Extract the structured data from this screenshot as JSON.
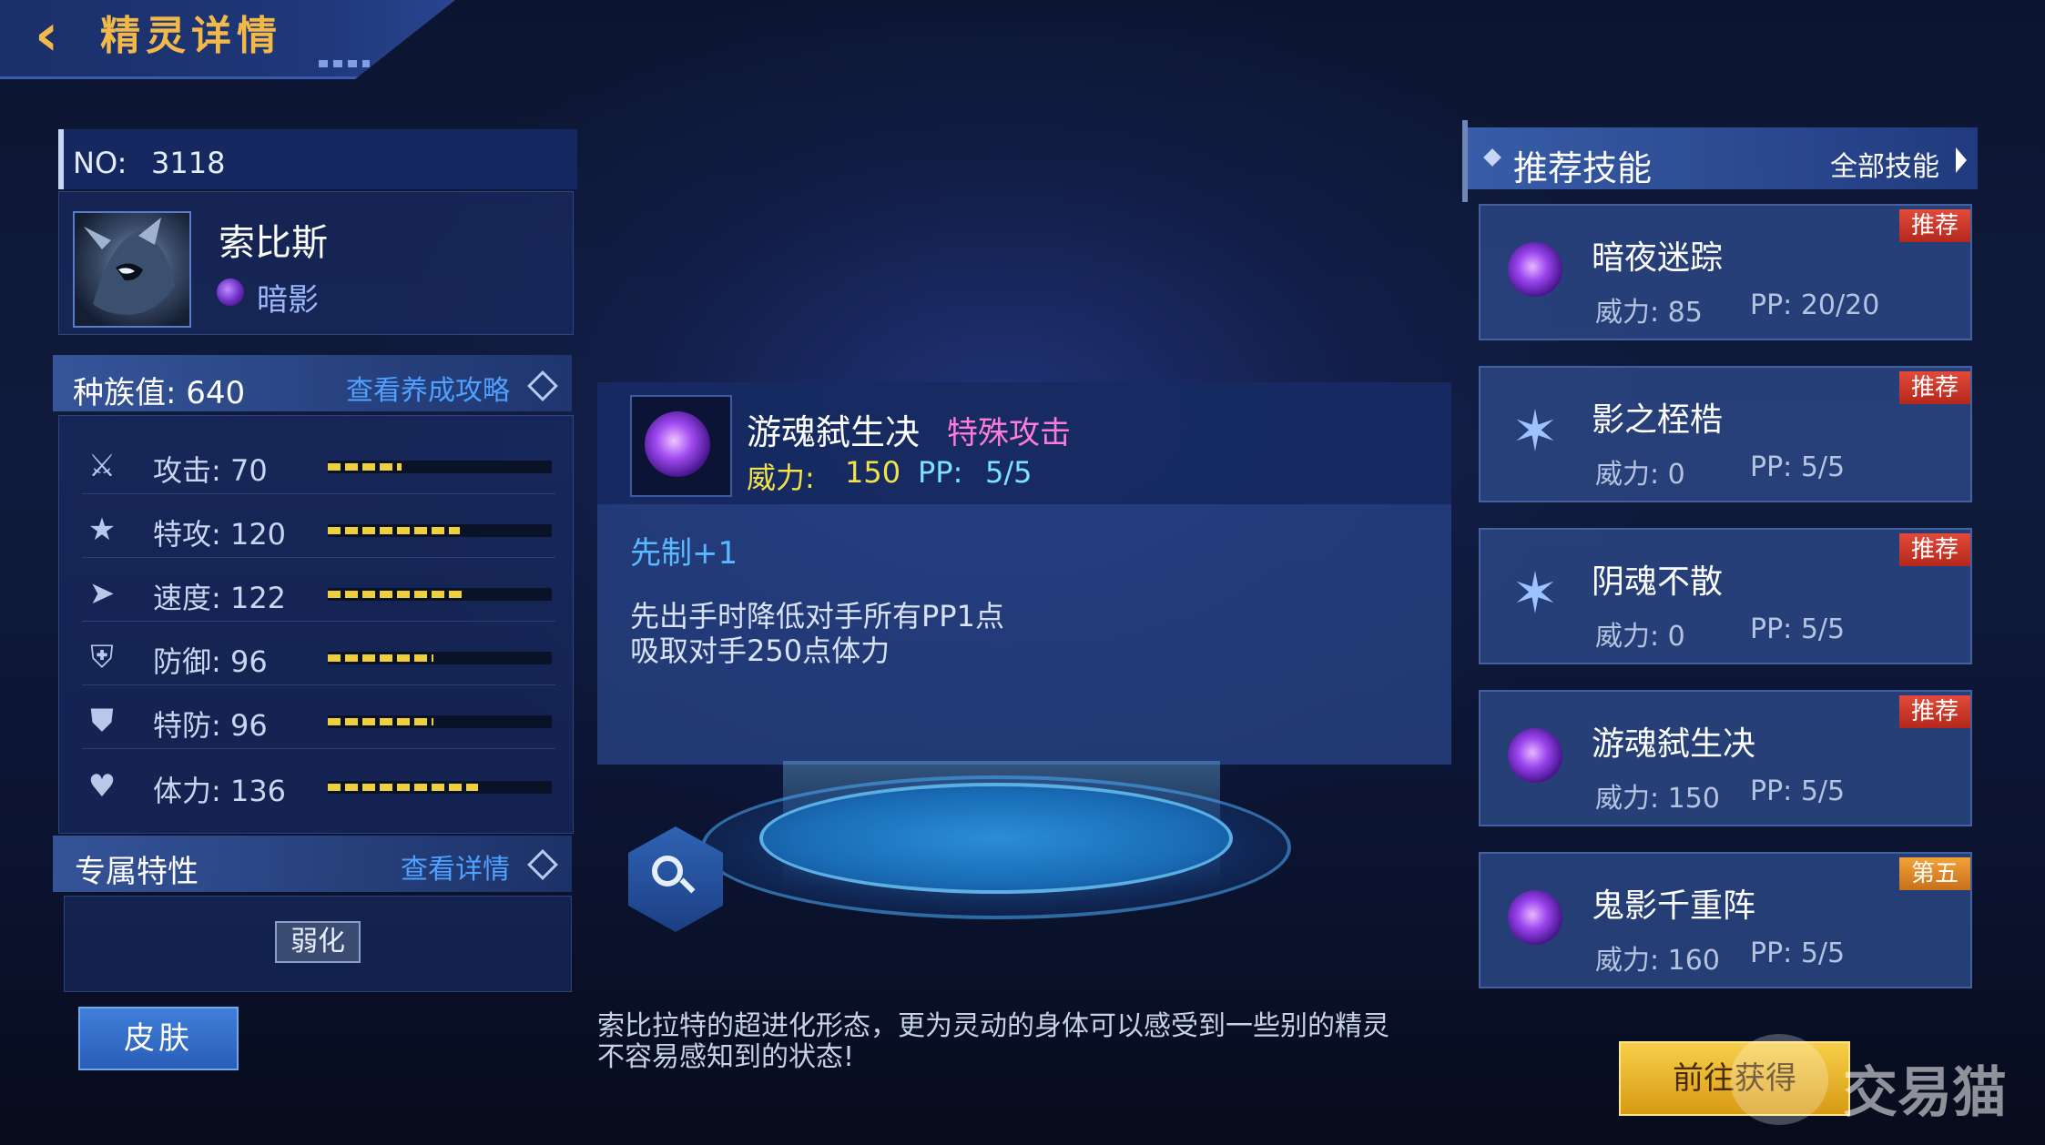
{
  "header": {
    "title": "精灵详情"
  },
  "pet": {
    "no_label": "NO:",
    "no_value": "3118",
    "name": "索比斯",
    "type": "暗影"
  },
  "race": {
    "label": "种族值:  640",
    "link": "查看养成攻略"
  },
  "stats": [
    {
      "label": "攻击:  70",
      "icon": "sword-icon",
      "fill": 0.33
    },
    {
      "label": "特攻:  120",
      "icon": "spark-icon",
      "fill": 0.59
    },
    {
      "label": "速度:  122",
      "icon": "boot-icon",
      "fill": 0.6
    },
    {
      "label": "防御:  96",
      "icon": "shield-icon",
      "fill": 0.47
    },
    {
      "label": "特防:  96",
      "icon": "magic-shield-icon",
      "fill": 0.47
    },
    {
      "label": "体力:  136",
      "icon": "heart-icon",
      "fill": 0.67
    }
  ],
  "trait": {
    "label": "专属特性",
    "link": "查看详情",
    "tag": "弱化"
  },
  "skin_button": "皮肤",
  "skill_detail": {
    "name": "游魂弑生决",
    "category": "特殊攻击",
    "power_label": "威力:",
    "power_value": "150",
    "pp_label": "PP:",
    "pp_value": "5/5",
    "priority": "先制+1",
    "effect_line1": "先出手时降低对手所有PP1点",
    "effect_line2": "吸取对手250点体力"
  },
  "description": {
    "line1": "索比拉特的超进化形态，更为灵动的身体可以感受到一些别的精灵",
    "line2": "不容易感知到的状态!"
  },
  "recommend": {
    "title": "推荐技能",
    "all_link": "全部技能",
    "skills": [
      {
        "name": "暗夜迷踪",
        "power": "威力:  85",
        "pp": "PP:   20/20",
        "badge": "推荐",
        "icon": "shadow-icon"
      },
      {
        "name": "影之桎梏",
        "power": "威力:  0",
        "pp": "PP:   5/5",
        "badge": "推荐",
        "icon": "star-icon"
      },
      {
        "name": "阴魂不散",
        "power": "威力:  0",
        "pp": "PP:   5/5",
        "badge": "推荐",
        "icon": "star-icon"
      },
      {
        "name": "游魂弑生决",
        "power": "威力:  150",
        "pp": "PP:   5/5",
        "badge": "推荐",
        "icon": "shadow-icon"
      },
      {
        "name": "鬼影千重阵",
        "power": "威力:  160",
        "pp": "PP:   5/5",
        "badge": "第五",
        "icon": "shadow-icon"
      }
    ]
  },
  "goto_button": "前往获得",
  "watermark": "交易猫"
}
